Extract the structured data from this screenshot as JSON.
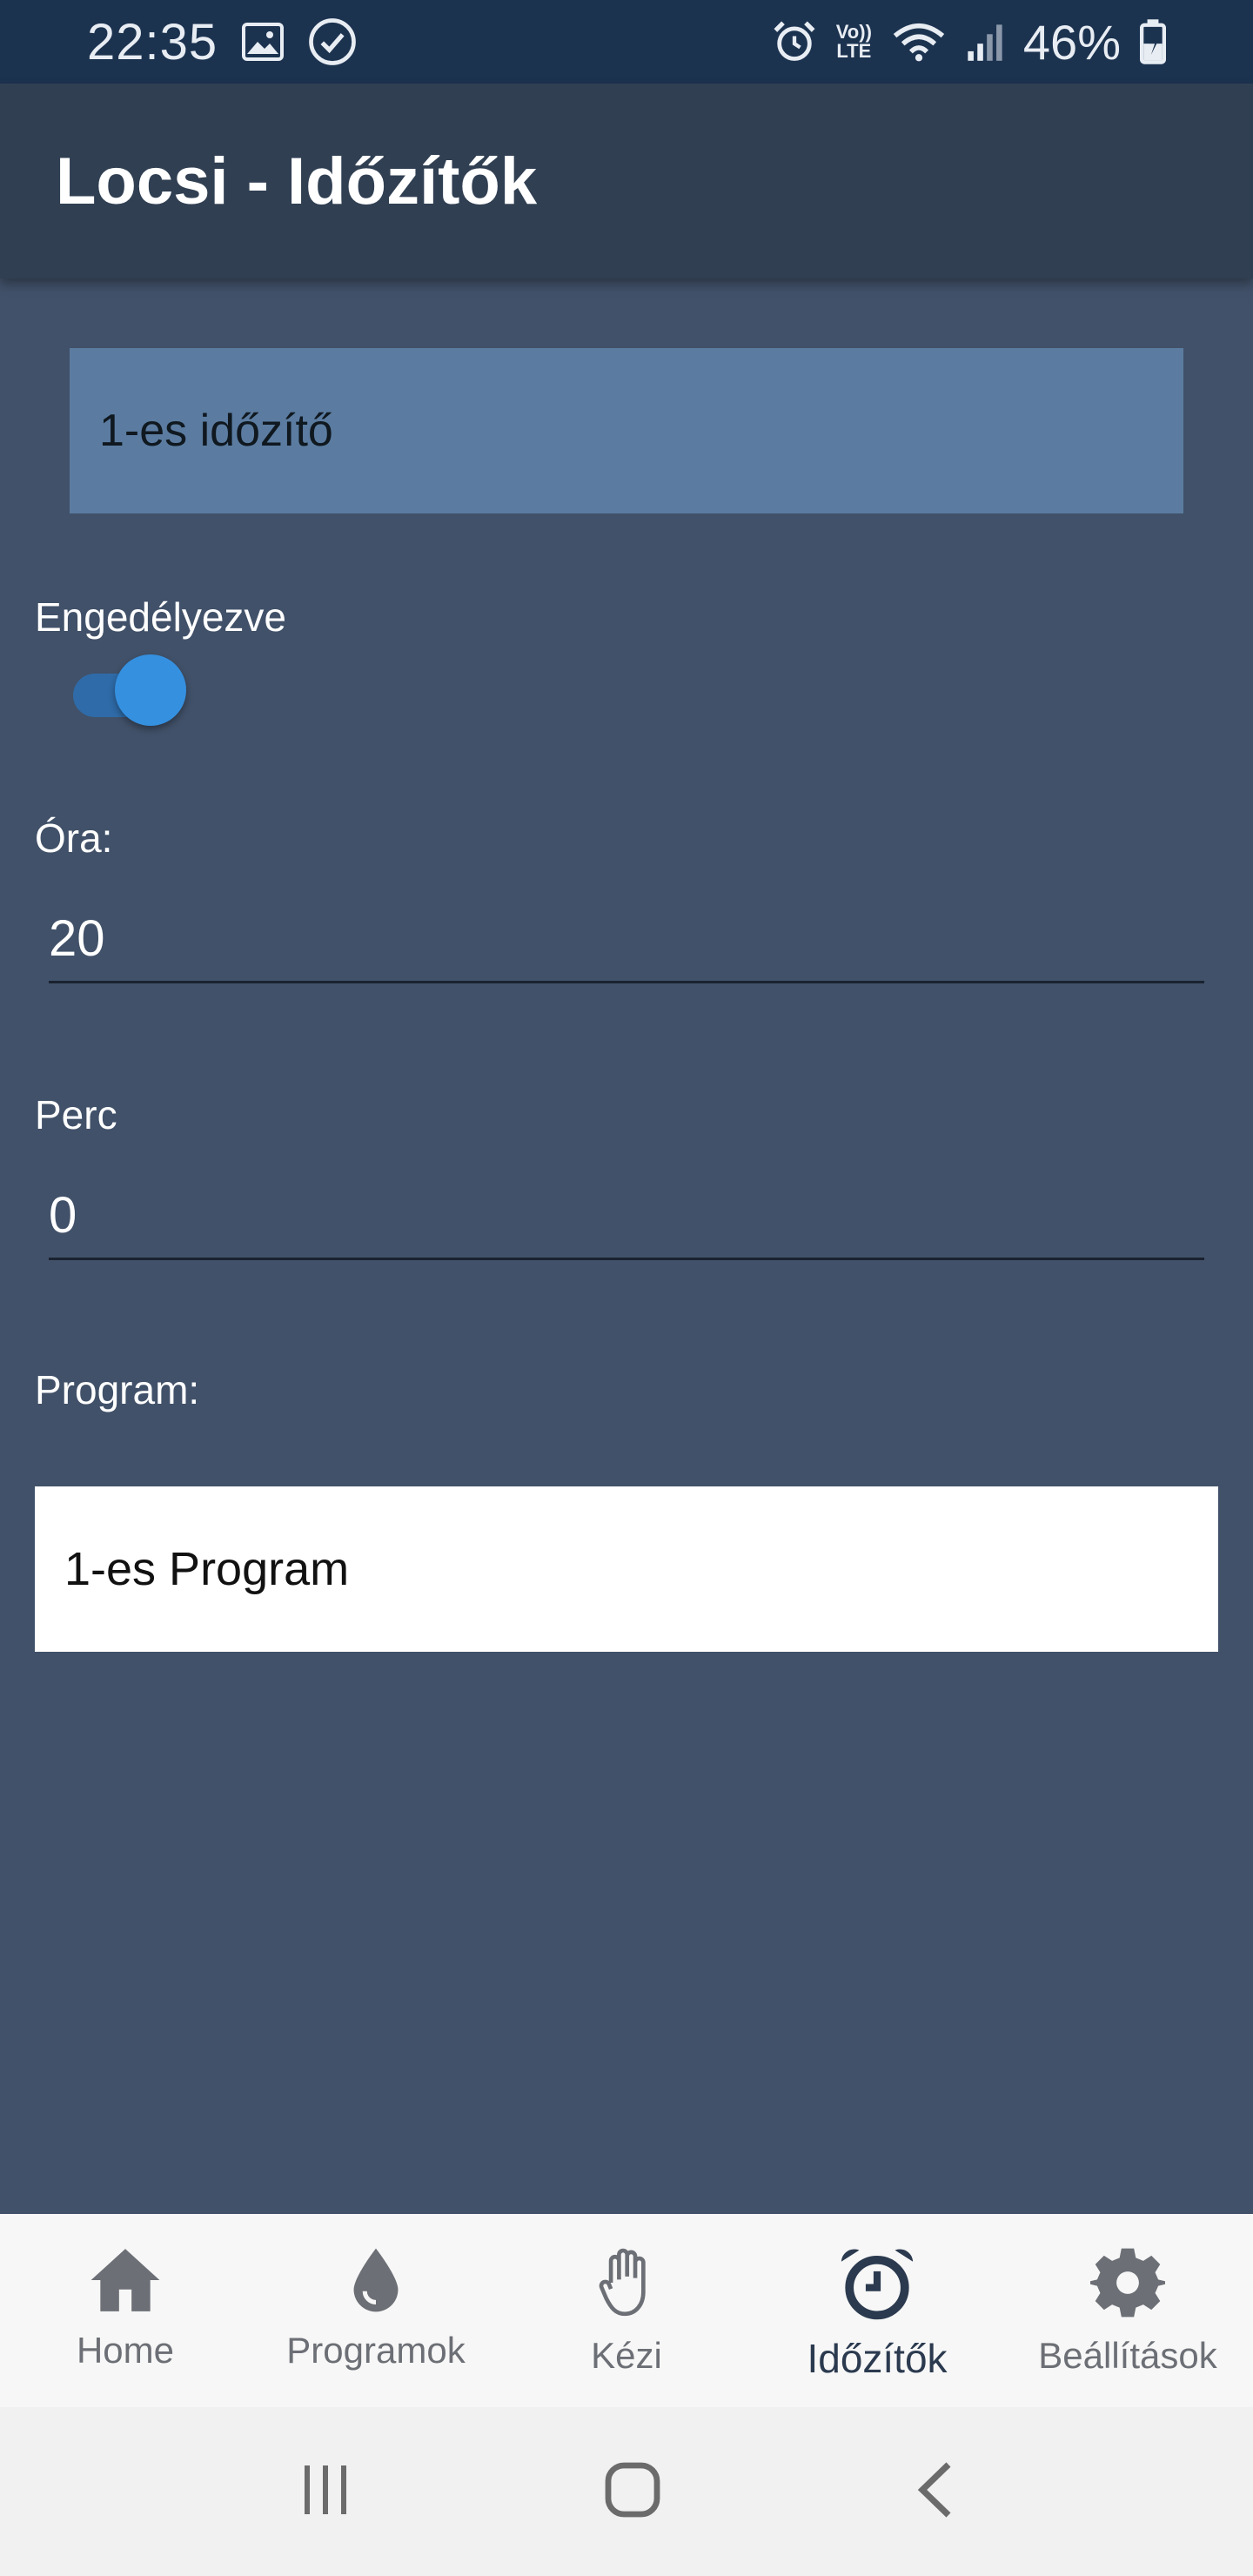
{
  "status_bar": {
    "time": "22:35",
    "lte_top": "Vo))",
    "lte_bottom": "LTE",
    "battery": "46%",
    "icons": [
      "image-icon",
      "check-circle-icon",
      "alarm-icon",
      "wifi-icon",
      "signal-icon",
      "battery-icon"
    ]
  },
  "app_bar": {
    "title": "Locsi - Időzítők"
  },
  "timer_select": {
    "value": "1-es időzítő"
  },
  "enabled": {
    "label": "Engedélyezve",
    "on": true
  },
  "hour": {
    "label": "Óra:",
    "value": "20"
  },
  "minute": {
    "label": "Perc",
    "value": "0"
  },
  "program": {
    "label": "Program:",
    "value": "1-es Program"
  },
  "bottom_nav": {
    "items": [
      {
        "label": "Home",
        "icon": "home-icon"
      },
      {
        "label": "Programok",
        "icon": "drop-icon"
      },
      {
        "label": "Kézi",
        "icon": "hand-icon"
      },
      {
        "label": "Időzítők",
        "icon": "alarm-clock-icon",
        "active": true
      },
      {
        "label": "Beállítások",
        "icon": "gear-icon"
      }
    ]
  },
  "colors": {
    "status_bar": "#1c3350",
    "app_bar": "#303f52",
    "background": "#415169",
    "timer_select": "#5b7ca0",
    "toggle_thumb": "#3590e0"
  }
}
